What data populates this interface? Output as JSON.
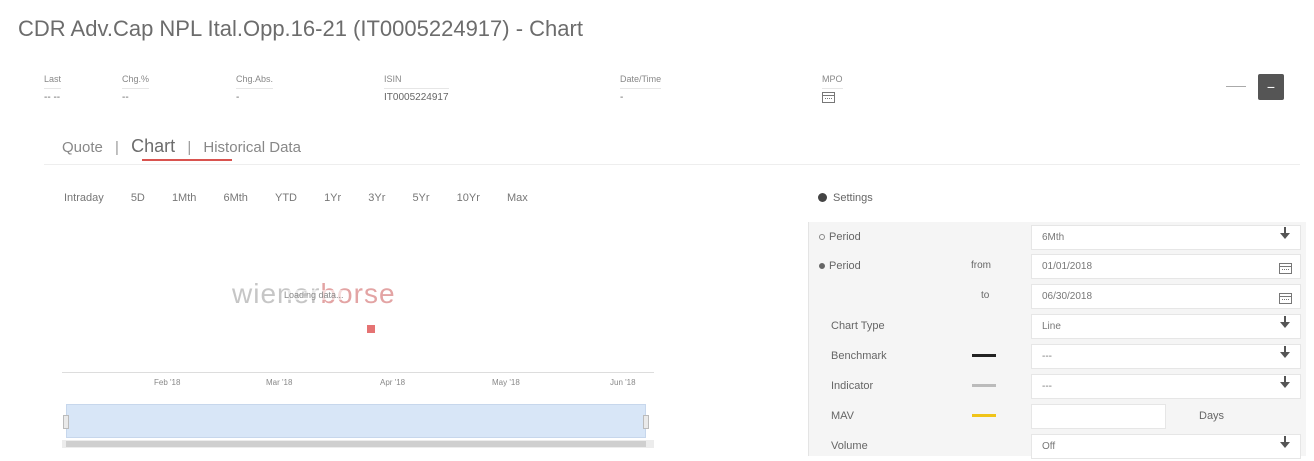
{
  "page": {
    "title": "CDR Adv.Cap NPL Ital.Opp.16-21 (IT0005224917) - Chart"
  },
  "info_table": {
    "columns": [
      {
        "header": "Last",
        "value": "-- --"
      },
      {
        "header": "Chg.%",
        "value": "--"
      },
      {
        "header": "Chg.Abs.",
        "value": "-"
      },
      {
        "header": "ISIN",
        "value": "IT0005224917"
      },
      {
        "header": "Date/Time",
        "value": "-"
      },
      {
        "header": "MPO",
        "value": ""
      }
    ]
  },
  "header_actions": {
    "collapse_label": "−"
  },
  "tabs": [
    {
      "label": "Quote",
      "active": false
    },
    {
      "label": "Chart",
      "active": true
    },
    {
      "label": "Historical Data",
      "active": false
    }
  ],
  "tab_separator": "|",
  "periods": [
    "Intraday",
    "5D",
    "1Mth",
    "6Mth",
    "YTD",
    "1Yr",
    "3Yr",
    "5Yr",
    "10Yr",
    "Max"
  ],
  "chart": {
    "logo_left": "wiener",
    "logo_right": "borse",
    "overlay_text": "Loading data...",
    "x_ticks": [
      "Feb '18",
      "Mar '18",
      "Apr '18",
      "May '18",
      "Jun '18"
    ],
    "navigator_label": "|||"
  },
  "settings": {
    "title": "Settings",
    "period_radio_label": "Period",
    "period_value": "6Mth",
    "range_radio_label": "Period",
    "from_label": "from",
    "from_value": "01/01/2018",
    "to_label": "to",
    "to_value": "06/30/2018",
    "chart_type_label": "Chart Type",
    "chart_type_value": "Line",
    "benchmark_label": "Benchmark",
    "benchmark_value": "---",
    "benchmark_color": "#222222",
    "indicator_label": "Indicator",
    "indicator_value": "---",
    "indicator_color": "#bbbbbb",
    "mav_label": "MAV",
    "mav_color": "#f0c419",
    "mav_days_label": "Days",
    "volume_label": "Volume",
    "volume_value": "Off"
  },
  "colors": {
    "accent_red": "#d9534f",
    "navigator_fill": "#d8e6f7",
    "settings_bg": "#f5f5f5"
  }
}
